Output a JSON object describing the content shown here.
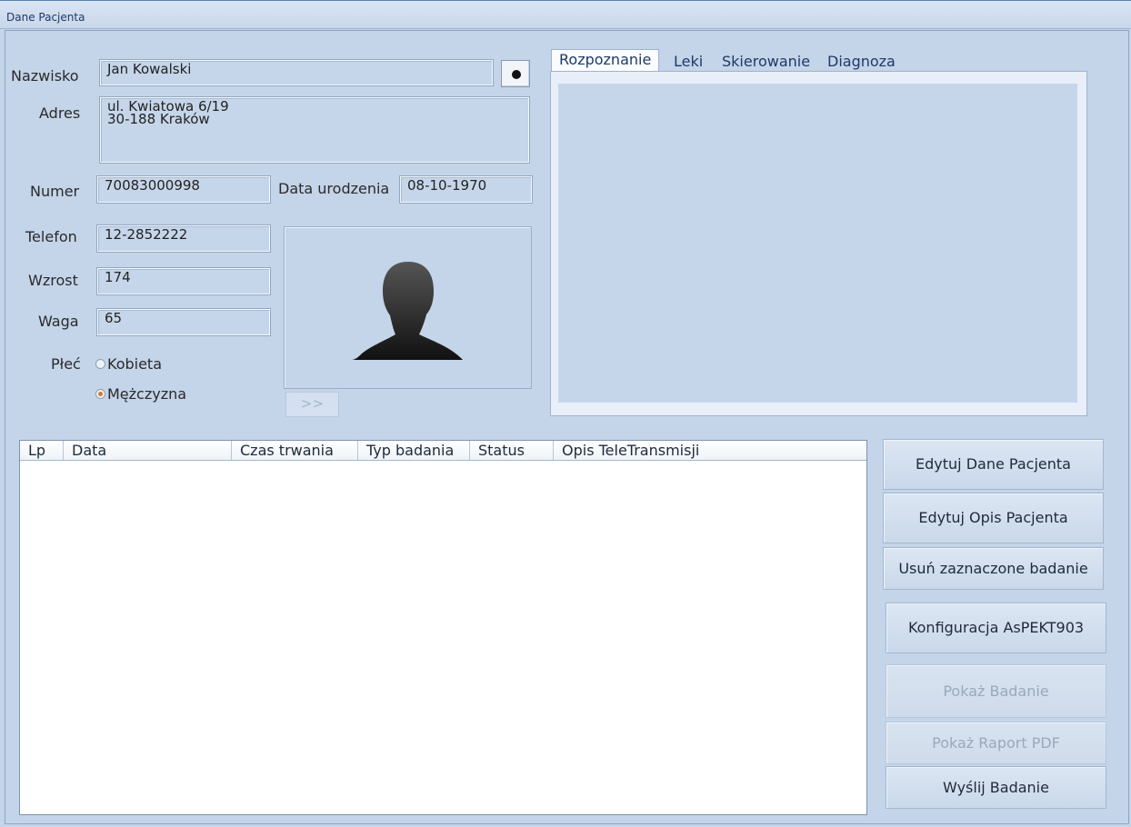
{
  "window": {
    "title": "Dane Pacjenta"
  },
  "form": {
    "surname_label": "Nazwisko",
    "surname_value": "Jan Kowalski",
    "address_label": "Adres",
    "address_value": "ul. Kwiatowa 6/19\n30-188 Kraków",
    "number_label": "Numer",
    "number_value": "70083000998",
    "birthdate_label": "Data urodzenia",
    "birthdate_value": "08-10-1970",
    "phone_label": "Telefon",
    "phone_value": "12-2852222",
    "height_label": "Wzrost",
    "height_value": "174",
    "weight_label": "Waga",
    "weight_value": "65",
    "sex_label": "Płeć",
    "sex_options": [
      "Kobieta",
      "Mężczyzna"
    ],
    "sex_selected": "Mężczyzna",
    "next_photo_label": ">>"
  },
  "tabs": [
    {
      "label": "Rozpoznanie",
      "active": true
    },
    {
      "label": "Leki",
      "active": false
    },
    {
      "label": "Skierowanie",
      "active": false
    },
    {
      "label": "Diagnoza",
      "active": false
    }
  ],
  "table": {
    "columns": [
      "Lp",
      "Data",
      "Czas trwania",
      "Typ badania",
      "Status",
      "Opis TeleTransmisji"
    ],
    "rows": []
  },
  "actions": {
    "edit_patient_data": "Edytuj Dane Pacjenta",
    "edit_patient_description": "Edytuj Opis Pacjenta",
    "delete_selected_exam": "Usuń zaznaczone badanie",
    "configuration": "Konfiguracja AsPEKT903",
    "show_exam": "Pokaż Badanie",
    "show_pdf_report": "Pokaż Raport PDF",
    "send_exam": "Wyślij Badanie"
  },
  "colors": {
    "selected_radio": "#d07a2a",
    "disabled_text": "#9aa8bb"
  }
}
